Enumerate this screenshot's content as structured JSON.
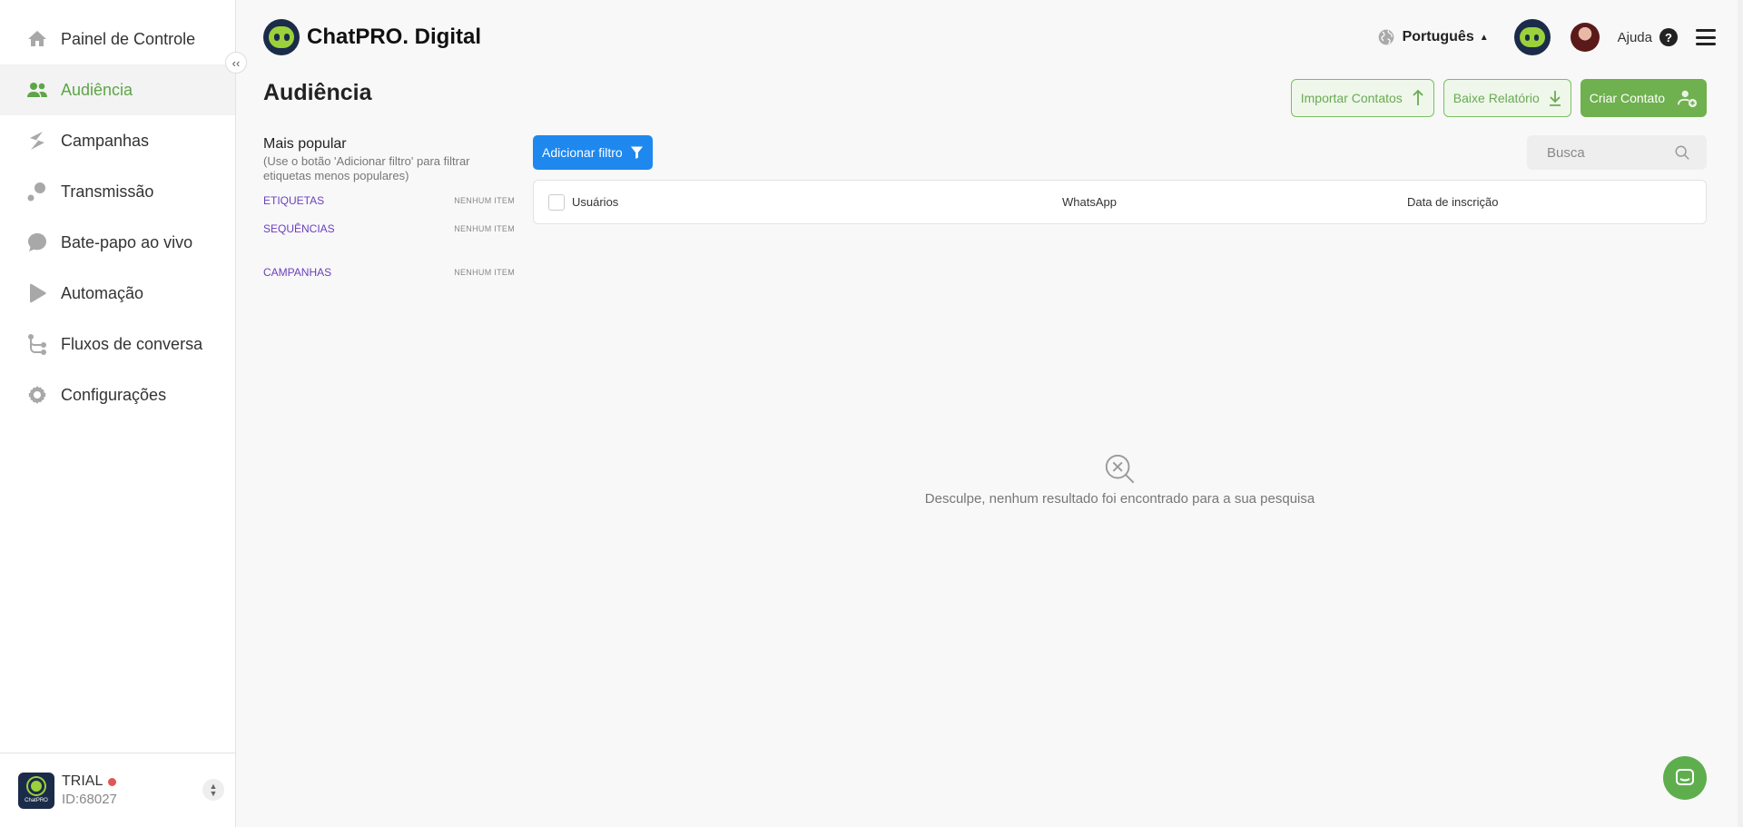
{
  "sidebar": {
    "items": [
      {
        "label": "Painel de Controle",
        "icon": "home-icon"
      },
      {
        "label": "Audiência",
        "icon": "users-icon",
        "active": true
      },
      {
        "label": "Campanhas",
        "icon": "campaign-icon"
      },
      {
        "label": "Transmissão",
        "icon": "broadcast-icon"
      },
      {
        "label": "Bate-papo ao vivo",
        "icon": "chat-bubble-icon"
      },
      {
        "label": "Automação",
        "icon": "play-icon"
      },
      {
        "label": "Fluxos de conversa",
        "icon": "flow-icon"
      },
      {
        "label": "Configurações",
        "icon": "gear-icon"
      }
    ],
    "collapse_label": "‹‹",
    "account": {
      "logo_text": "ChatPRO",
      "plan": "TRIAL",
      "id": "ID:68027"
    }
  },
  "header": {
    "brand": "ChatPRO. Digital",
    "language": "Português",
    "help": "Ajuda"
  },
  "page": {
    "title": "Audiência",
    "actions": {
      "import": "Importar Contatos",
      "report": "Baixe Relatório",
      "create": "Criar Contato"
    }
  },
  "filters": {
    "title": "Mais popular",
    "hint": "(Use o botão 'Adicionar filtro' para filtrar etiquetas menos populares)",
    "groups": [
      {
        "name": "ETIQUETAS",
        "count": "NENHUM ITEM"
      },
      {
        "name": "SEQUÊNCIAS",
        "count": "NENHUM ITEM"
      },
      {
        "name": "CAMPANHAS",
        "count": "NENHUM ITEM"
      }
    ]
  },
  "main": {
    "add_filter": "Adicionar filtro",
    "search_placeholder": "Busca",
    "columns": [
      "Usuários",
      "WhatsApp",
      "Data de inscrição"
    ],
    "empty_message": "Desculpe, nenhum resultado foi encontrado para a sua pesquisa"
  },
  "colors": {
    "accent": "#6fb04f",
    "primary_blue": "#1e88ef",
    "link_purple": "#6b3fbf"
  }
}
